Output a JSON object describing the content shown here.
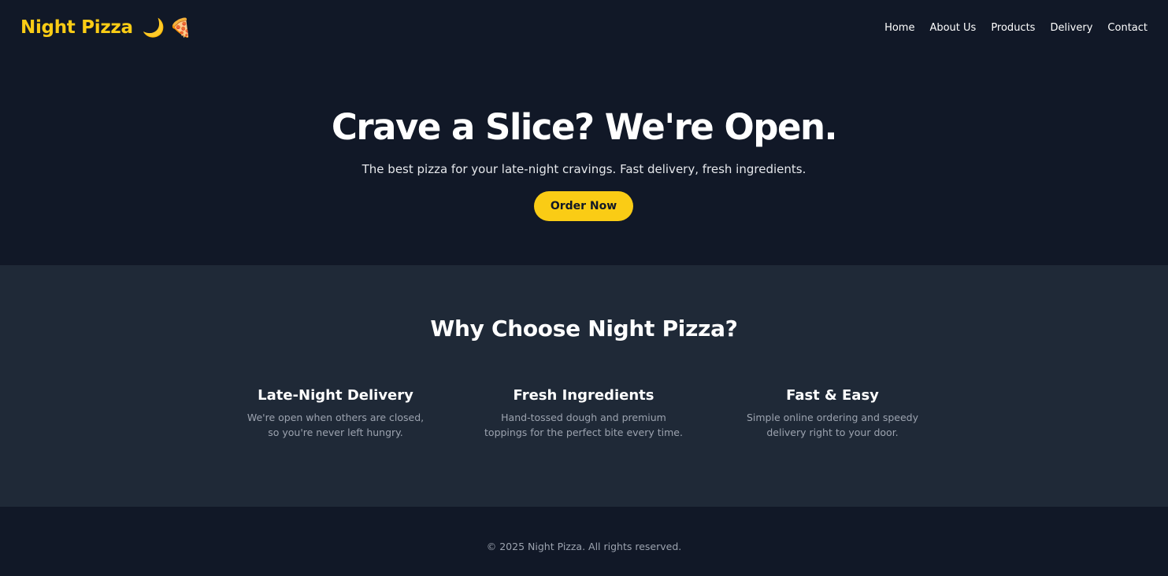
{
  "brand": {
    "name": "Night Pizza",
    "moon_icon": "🌙",
    "pizza_icon": "🍕",
    "color": "#facc15"
  },
  "nav": {
    "items": [
      {
        "label": "Home"
      },
      {
        "label": "About Us"
      },
      {
        "label": "Products"
      },
      {
        "label": "Delivery"
      },
      {
        "label": "Contact"
      }
    ]
  },
  "hero": {
    "title": "Crave a Slice? We're Open.",
    "subtitle": "The best pizza for your late-night cravings. Fast delivery, fresh ingredients.",
    "cta_label": "Order Now"
  },
  "features": {
    "heading": "Why Choose Night Pizza?",
    "items": [
      {
        "title": "Late-Night Delivery",
        "description": "We're open when others are closed, so you're never left hungry."
      },
      {
        "title": "Fresh Ingredients",
        "description": "Hand-tossed dough and premium toppings for the perfect bite every time."
      },
      {
        "title": "Fast & Easy",
        "description": "Simple online ordering and speedy delivery right to your door."
      }
    ]
  },
  "footer": {
    "text": "© 2025 Night Pizza. All rights reserved."
  },
  "colors": {
    "background": "#111827",
    "section_background": "#1f2937",
    "accent": "#facc15",
    "muted_text": "#9ca3af"
  }
}
